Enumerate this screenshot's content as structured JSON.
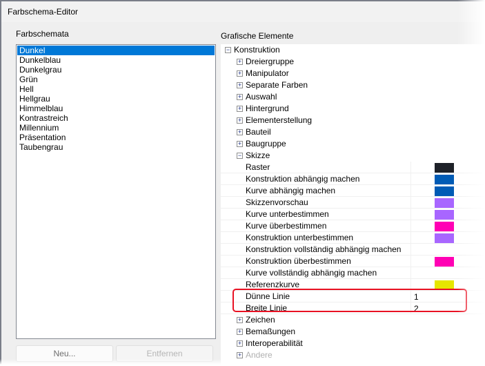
{
  "window": {
    "title": "Farbschema-Editor"
  },
  "schemes": {
    "label": "Farbschemata",
    "items": [
      "Dunkel",
      "Dunkelblau",
      "Dunkelgrau",
      "Grün",
      "Hell",
      "Hellgrau",
      "Himmelblau",
      "Kontrastreich",
      "Millennium",
      "Präsentation",
      "Taubengrau"
    ],
    "selected": "Dunkel",
    "new_button": "Neu...",
    "remove_button": "Entfernen"
  },
  "elements": {
    "label": "Grafische Elemente",
    "root": "Konstruktion",
    "groups_before": [
      "Dreiergruppe",
      "Manipulator",
      "Separate Farben",
      "Auswahl",
      "Hintergrund",
      "Elementerstellung",
      "Bauteil",
      "Baugruppe"
    ],
    "sketch": "Skizze",
    "sketch_items": [
      {
        "label": "Raster",
        "color": "#1e2128"
      },
      {
        "label": "Konstruktion abhängig machen",
        "color": "#005bb5"
      },
      {
        "label": "Kurve abhängig machen",
        "color": "#005bb5"
      },
      {
        "label": "Skizzenvorschau",
        "color": "#a866ff"
      },
      {
        "label": "Kurve unterbestimmen",
        "color": "#a866ff"
      },
      {
        "label": "Kurve überbestimmen",
        "color": "#ff00b4"
      },
      {
        "label": "Konstruktion unterbestimmen",
        "color": "#a866ff"
      },
      {
        "label": "Konstruktion vollständig abhängig machen",
        "color": null
      },
      {
        "label": "Konstruktion überbestimmen",
        "color": "#ff00b4"
      },
      {
        "label": "Kurve vollständig abhängig machen",
        "color": null
      },
      {
        "label": "Referenzkurve",
        "color": "#e6e600"
      },
      {
        "label": "Dünne Linie",
        "value": "1"
      },
      {
        "label": "Breite Linie",
        "value": "2"
      }
    ],
    "groups_after": [
      "Zeichen",
      "Bemaßungen",
      "Interoperabilität",
      "Andere"
    ]
  }
}
